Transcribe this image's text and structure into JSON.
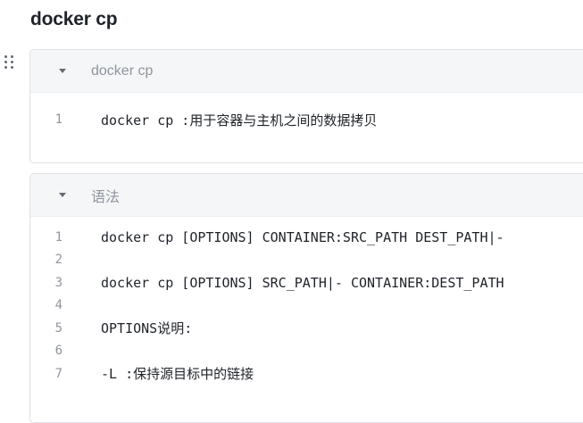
{
  "page": {
    "title": "docker cp"
  },
  "blocks": [
    {
      "title": "docker cp",
      "lines": [
        {
          "num": "1",
          "code": "docker cp :用于容器与主机之间的数据拷贝"
        }
      ]
    },
    {
      "title": "语法",
      "lines": [
        {
          "num": "1",
          "code": "docker cp [OPTIONS] CONTAINER:SRC_PATH DEST_PATH|-"
        },
        {
          "num": "2",
          "code": ""
        },
        {
          "num": "3",
          "code": "docker cp [OPTIONS] SRC_PATH|- CONTAINER:DEST_PATH"
        },
        {
          "num": "4",
          "code": ""
        },
        {
          "num": "5",
          "code": "OPTIONS说明:"
        },
        {
          "num": "6",
          "code": ""
        },
        {
          "num": "7",
          "code": "-L :保持源目标中的链接"
        }
      ]
    }
  ],
  "icons": {
    "drag_handle": "drag-handle-icon",
    "collapse": "caret-down-icon"
  }
}
